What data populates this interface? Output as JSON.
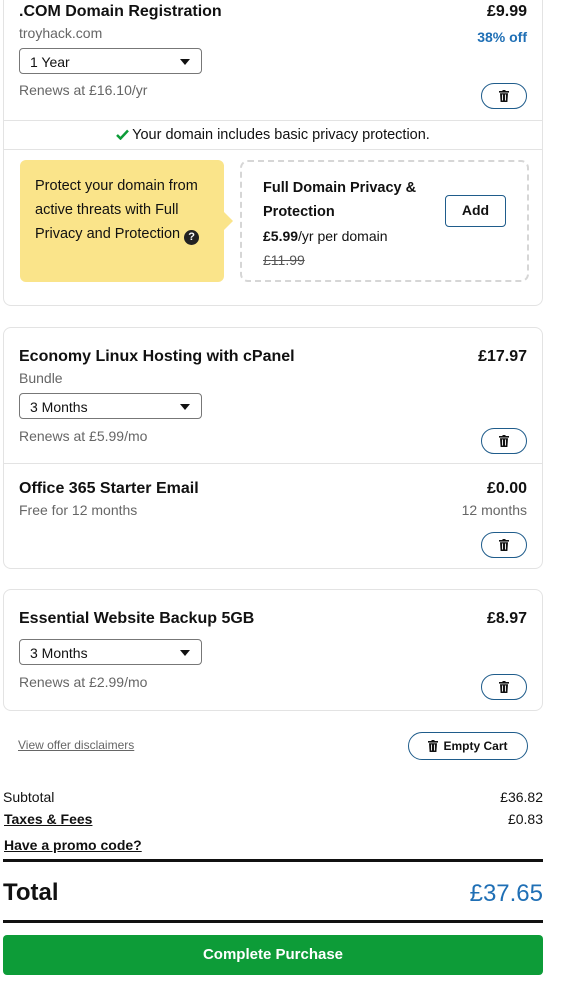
{
  "domain_item": {
    "title": ".COM Domain Registration",
    "domain": "troyhack.com",
    "price": "£9.99",
    "discount": "38% off",
    "term": "1 Year",
    "renews": "Renews at £16.10/yr",
    "privacy_note": "Your domain includes basic privacy protection.",
    "callout_text": "Protect your domain from active threats with Full Privacy and Protection",
    "offer_title": "Full Domain Privacy & Protection",
    "offer_price": "£5.99",
    "offer_unit": "/yr per domain",
    "offer_old_price": "£11.99",
    "add_label": "Add"
  },
  "hosting_item": {
    "title": "Economy Linux Hosting with cPanel",
    "sub": "Bundle",
    "price": "£17.97",
    "term": "3 Months",
    "renews": "Renews at £5.99/mo"
  },
  "email_item": {
    "title": "Office 365 Starter Email",
    "sub": "Free for 12 months",
    "price": "£0.00",
    "term_note": "12 months"
  },
  "backup_item": {
    "title": "Essential Website Backup 5GB",
    "price": "£8.97",
    "term": "3 Months",
    "renews": "Renews at £2.99/mo"
  },
  "footer": {
    "disclaimers": "View offer disclaimers",
    "empty_cart": "Empty Cart",
    "subtotal_label": "Subtotal",
    "subtotal_value": "£36.82",
    "taxes_label": "Taxes & Fees",
    "taxes_value": "£0.83",
    "promo_label": "Have a promo code?",
    "total_label": "Total",
    "total_value": "£37.65",
    "purchase_label": "Complete Purchase"
  },
  "colors": {
    "accent_blue": "#1f6fb5",
    "callout_yellow": "#fae48a",
    "purchase_green": "#0d9c38",
    "check_green": "#0d9c38"
  },
  "icons": [
    "trash-icon",
    "checkmark-icon",
    "question-icon",
    "chevron-down-icon"
  ]
}
